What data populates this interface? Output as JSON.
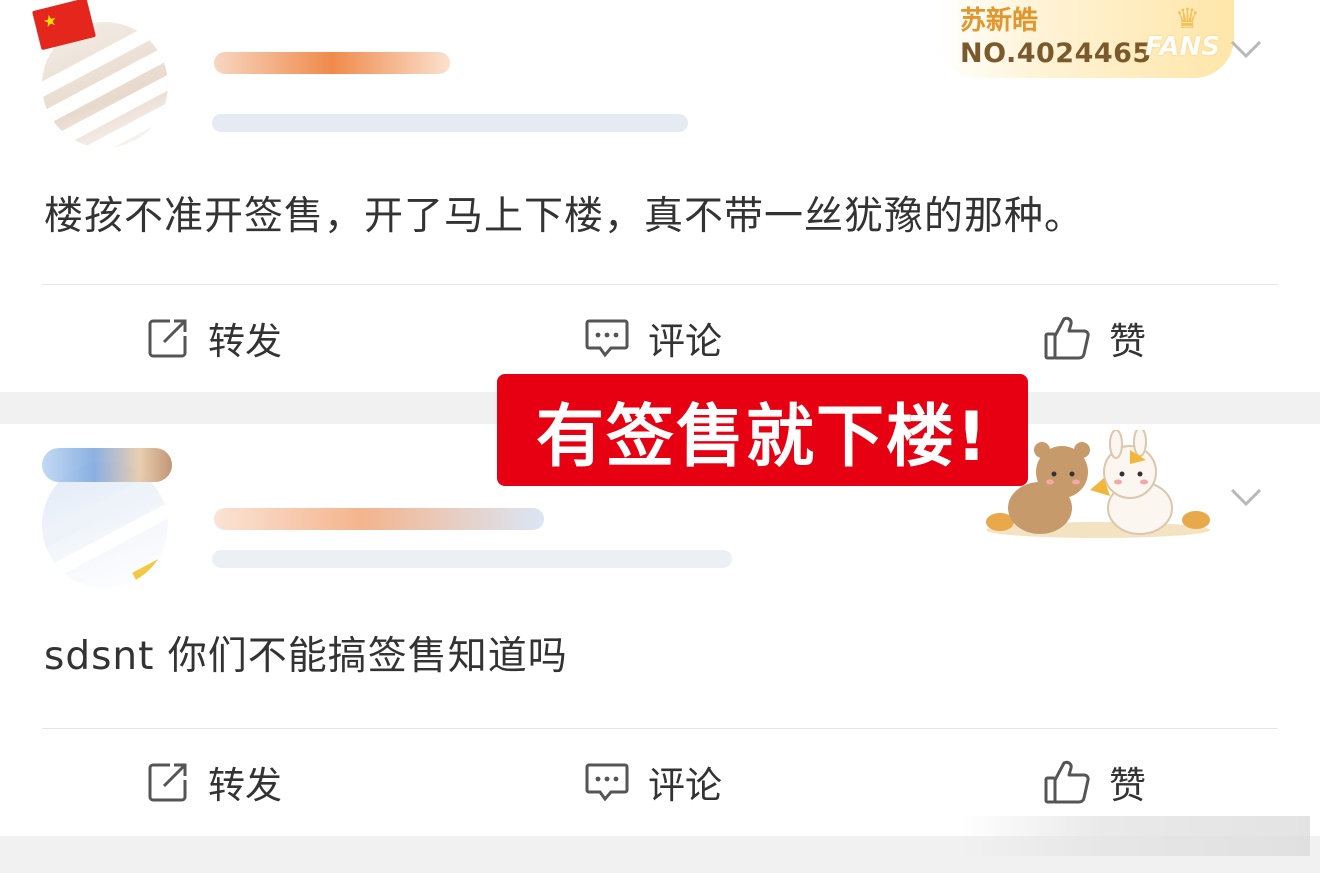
{
  "posts": [
    {
      "comment": "楼孩不准开签售，开了马上下楼，真不带一丝犹豫的那种。",
      "badge": {
        "name": "苏新皓",
        "number": "NO.4024465",
        "label": "FANS"
      },
      "actions": {
        "repost": "转发",
        "comment": "评论",
        "like": "赞"
      }
    },
    {
      "comment": "sdsnt 你们不能搞签售知道吗",
      "actions": {
        "repost": "转发",
        "comment": "评论",
        "like": "赞"
      }
    }
  ],
  "overlay": {
    "banner_text": "有签售就下楼!"
  },
  "colors": {
    "banner_red": "#e60012",
    "badge_gold": "#e2962b",
    "divider": "#e6e6e6",
    "section_gap": "#f1f1f1"
  },
  "icons": [
    "repost-icon",
    "comment-icon",
    "like-icon",
    "chevron-down-icon",
    "crown-icon"
  ]
}
